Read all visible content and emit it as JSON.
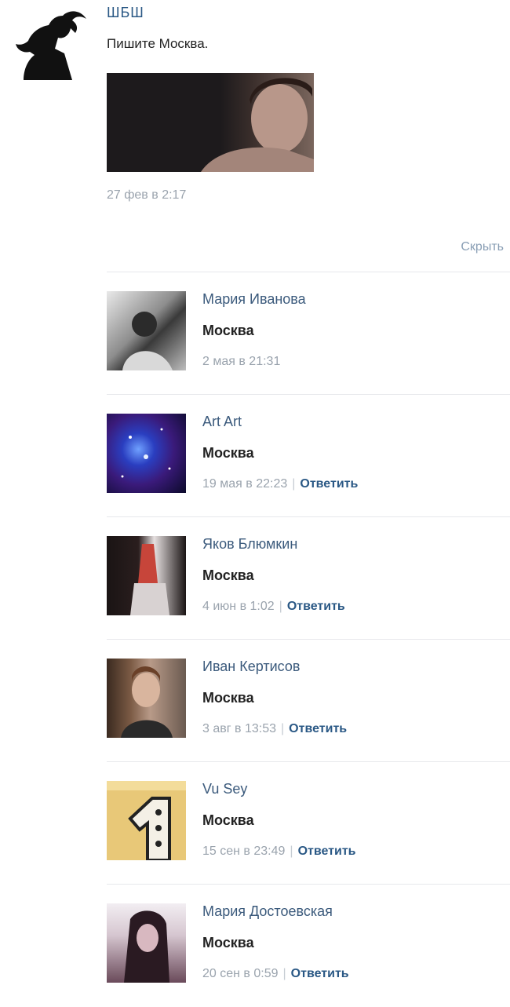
{
  "post": {
    "author": "ШБШ",
    "text": "Пишите Москва.",
    "date": "27 фев в 2:17",
    "hide_label": "Скрыть"
  },
  "comments": [
    {
      "name": "Мария Иванова",
      "text": "Москва",
      "date": "2 мая в 21:31",
      "reply": ""
    },
    {
      "name": "Art Art",
      "text": "Москва",
      "date": "19 мая в 22:23",
      "reply": "Ответить"
    },
    {
      "name": "Яков Блюмкин",
      "text": "Москва",
      "date": "4 июн в 1:02",
      "reply": "Ответить"
    },
    {
      "name": "Иван Кертисов",
      "text": "Москва",
      "date": "3 авг в 13:53",
      "reply": "Ответить"
    },
    {
      "name": "Vu Sey",
      "text": "Москва",
      "date": "15 сен в 23:49",
      "reply": "Ответить"
    },
    {
      "name": "Мария Достоевская",
      "text": "Москва",
      "date": "20 сен в 0:59",
      "reply": "Ответить"
    }
  ],
  "colors": {
    "link": "#2a5885",
    "meta": "#9aa3ad",
    "divider": "#e7e8ec"
  }
}
